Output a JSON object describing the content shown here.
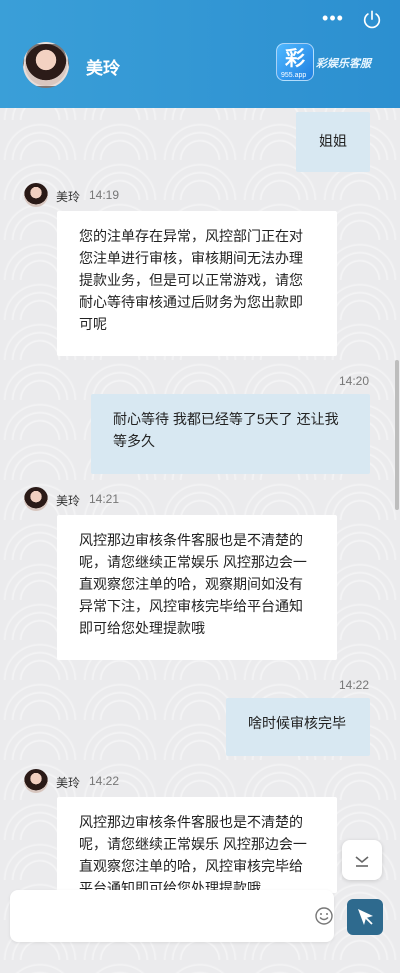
{
  "header": {
    "agent_name": "美玲",
    "brand_logo_char": "彩",
    "brand_logo_sub": "955.app",
    "brand_text": "彩娱乐客服"
  },
  "messages": [
    {
      "id": "m1",
      "direction": "out",
      "time": "",
      "text": "姐姐"
    },
    {
      "id": "m2",
      "direction": "in",
      "sender": "美玲",
      "time": "14:19",
      "text": "您的注单存在异常，风控部门正在对您注单进行审核，审核期间无法办理提款业务，但是可以正常游戏，请您耐心等待审核通过后财务为您出款即可呢"
    },
    {
      "id": "m3",
      "direction": "out",
      "time": "14:20",
      "text": "耐心等待 我都已经等了5天了 还让我等多久"
    },
    {
      "id": "m4",
      "direction": "in",
      "sender": "美玲",
      "time": "14:21",
      "text": "风控那边审核条件客服也是不清楚的呢，请您继续正常娱乐 风控那边会一直观察您注单的哈，观察期间如没有异常下注，风控审核完毕给平台通知即可给您处理提款哦"
    },
    {
      "id": "m5",
      "direction": "out",
      "time": "14:22",
      "text": "啥时候审核完毕"
    },
    {
      "id": "m6",
      "direction": "in",
      "sender": "美玲",
      "time": "14:22",
      "text": "风控那边审核条件客服也是不清楚的呢，请您继续正常娱乐 风控那边会一直观察您注单的哈，风控审核完毕给平台通知即可给您处理提款哦"
    }
  ],
  "composer": {
    "placeholder": "",
    "value": ""
  },
  "icons": {
    "more": "more-icon",
    "power": "power-icon",
    "emoji": "emoji-icon",
    "send": "send-icon",
    "scroll_down": "chevron-down-icon"
  },
  "colors": {
    "header": "#2c8fd0",
    "outgoing_bubble": "#d8e8f2",
    "incoming_bubble": "#ffffff",
    "send_button": "#2e6a8e"
  }
}
